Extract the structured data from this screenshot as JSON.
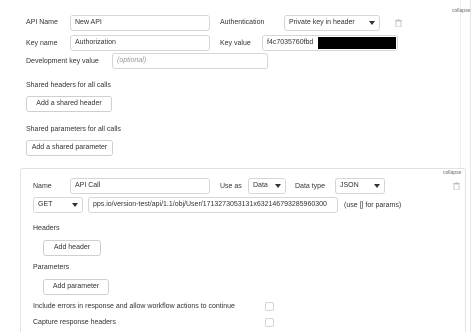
{
  "top_right_text": "collapse",
  "api": {
    "name_label": "API Name",
    "name_value": "New API",
    "auth_label": "Authentication",
    "auth_value": "Private key in header",
    "key_name_label": "Key name",
    "key_name_value": "Authorization",
    "key_value_label": "Key value",
    "key_value_visible": "f4c7035760fbd",
    "dev_key_label": "Development key value",
    "dev_key_placeholder": "(optional)"
  },
  "shared_headers": {
    "title": "Shared headers for all calls",
    "button": "Add a shared header"
  },
  "shared_params": {
    "title": "Shared parameters for all calls",
    "button": "Add a shared parameter"
  },
  "call": {
    "collapse": "collapse",
    "name_label": "Name",
    "name_value": "API Call",
    "use_as_label": "Use as",
    "use_as_value": "Data",
    "data_type_label": "Data type",
    "data_type_value": "JSON",
    "method": "GET",
    "url": "pps.io/version-test/api/1.1/obj/User/1713273053131x632146793285960300",
    "params_hint": "(use [] for params)",
    "headers_title": "Headers",
    "add_header": "Add header",
    "parameters_title": "Parameters",
    "add_parameter": "Add parameter",
    "include_errors": "Include errors in response and allow workflow actions to continue",
    "capture_headers": "Capture response headers"
  },
  "icons": {
    "delete": "trash-icon",
    "dropdown": "chevron-down-icon"
  }
}
